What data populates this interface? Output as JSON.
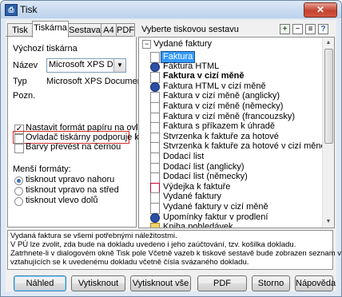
{
  "window": {
    "title": "Tisk",
    "close_glyph": "✕",
    "app_icon": "printer-icon"
  },
  "tabs": [
    {
      "label": "Tisk",
      "active": false
    },
    {
      "label": "Tiskárna",
      "active": true
    },
    {
      "label": "Sestava",
      "active": false
    },
    {
      "label": "A4",
      "active": false
    },
    {
      "label": "PDF",
      "active": false
    }
  ],
  "select_hint": "Vyberte tiskovou sestavu",
  "toolbar": {
    "add": "+",
    "remove": "−",
    "doc": "≡",
    "help": "?"
  },
  "printer": {
    "default_heading": "Výchozí tiskárna",
    "name_label": "Název",
    "name_value": "Microsoft XPS Document Writer",
    "type_label": "Typ",
    "type_value": "Microsoft XPS Document",
    "note_label": "Pozn."
  },
  "options": [
    {
      "label": "Nastavit formát papíru na ovladač",
      "checked": true
    },
    {
      "label": "Ovladač tiskárny podporuje kopie",
      "checked": false
    },
    {
      "label": "Barvy převést na černou",
      "checked": false
    }
  ],
  "smaller_formats": {
    "heading": "Menší formáty:",
    "options": [
      {
        "label": "tisknout vpravo nahoru",
        "selected": true
      },
      {
        "label": "tisknout vpravo na střed",
        "selected": false
      },
      {
        "label": "tisknout vlevo dolů",
        "selected": false
      }
    ]
  },
  "tree": {
    "root": "Vydané faktury",
    "items": [
      {
        "label": "Faktura",
        "icon": "report-icon",
        "selected": true,
        "bold": false
      },
      {
        "label": "Faktura HTML",
        "icon": "html-icon",
        "selected": false,
        "bold": false
      },
      {
        "label": "Faktura v cizí měně",
        "icon": "report-icon",
        "selected": false,
        "bold": true
      },
      {
        "label": "Faktura HTML v cizí měně",
        "icon": "html-icon",
        "selected": false,
        "bold": false
      },
      {
        "label": "Faktura v cizí měně (anglicky)",
        "icon": "report-icon",
        "selected": false,
        "bold": false
      },
      {
        "label": "Faktura v cizí měně (německy)",
        "icon": "report-icon",
        "selected": false,
        "bold": false
      },
      {
        "label": "Faktura v cizí měně (francouzsky)",
        "icon": "report-icon",
        "selected": false,
        "bold": false
      },
      {
        "label": "Faktura s příkazem k úhradě",
        "icon": "report-icon",
        "selected": false,
        "bold": false
      },
      {
        "label": "Stvrzenka k faktuře za hotové",
        "icon": "report-icon",
        "selected": false,
        "bold": false
      },
      {
        "label": "Stvrzenka k faktuře za hotové v cizí měně",
        "icon": "report-icon",
        "selected": false,
        "bold": false
      },
      {
        "label": "Dodací list",
        "icon": "report-icon",
        "selected": false,
        "bold": false
      },
      {
        "label": "Dodací list (anglicky)",
        "icon": "report-icon",
        "selected": false,
        "bold": false
      },
      {
        "label": "Dodací list (německy)",
        "icon": "report-icon",
        "selected": false,
        "bold": false
      },
      {
        "label": "Výdejka k faktuře",
        "icon": "red-report-icon",
        "selected": false,
        "bold": false
      },
      {
        "label": "Vydané faktury",
        "icon": "report-icon",
        "selected": false,
        "bold": false
      },
      {
        "label": "Vydané faktury v cizí měně",
        "icon": "report-icon",
        "selected": false,
        "bold": false
      },
      {
        "label": "Upomínky faktur v prodlení",
        "icon": "html-icon",
        "selected": false,
        "bold": false
      },
      {
        "label": "Kniha pohledávek",
        "icon": "book-icon",
        "selected": false,
        "bold": false
      }
    ]
  },
  "info_lines": [
    "Vydaná faktura se všemi potřebnými náležitostmi.",
    "V PÚ lze zvolit, zda bude na dokladu uvedeno i jeho zaúčtování, tzv. košilka dokladu.",
    "Zatrhnete-li v dialogovém okně Tisk pole Včetně vazeb k tiskové sestavě bude zobrazen seznam vazeb",
    "vztahujících se k uvedenému dokladu včetně čísla svázaného dokladu."
  ],
  "buttons": {
    "preview": "Náhled",
    "print": "Vytisknout",
    "print_all": "Vytisknout vše",
    "pdf": "PDF",
    "cancel": "Storno",
    "help": "Nápověda"
  }
}
